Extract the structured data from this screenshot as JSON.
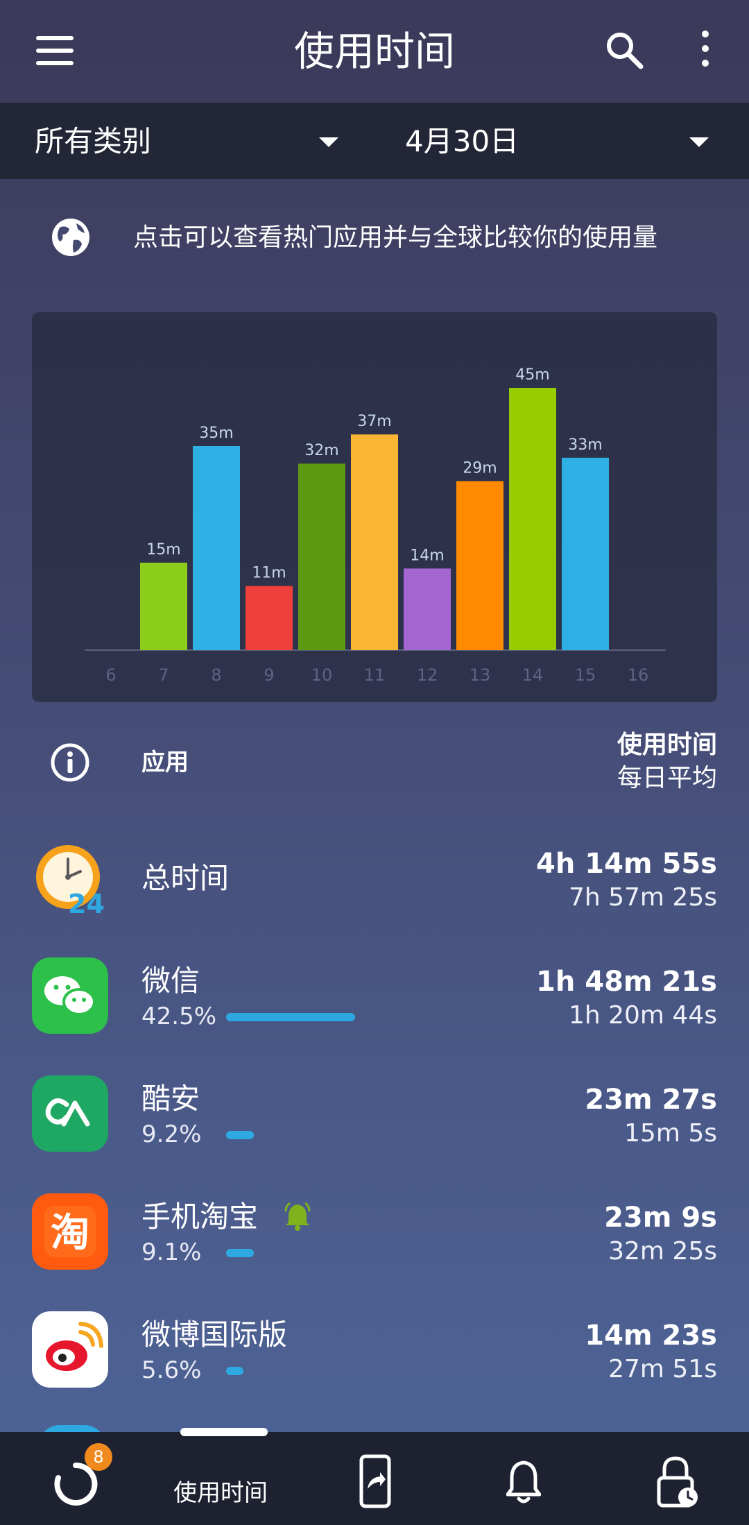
{
  "header": {
    "title": "使用时间"
  },
  "filters": {
    "category": "所有类别",
    "date": "4月30日"
  },
  "hint": {
    "text": "点击可以查看热门应用并与全球比较你的使用量"
  },
  "chart_data": {
    "type": "bar",
    "x_ticks": [
      "6",
      "7",
      "8",
      "9",
      "10",
      "11",
      "12",
      "13",
      "14",
      "15",
      "16"
    ],
    "categories": [
      "7",
      "8",
      "9",
      "10",
      "11",
      "12",
      "13",
      "14",
      "15"
    ],
    "values": [
      15,
      35,
      11,
      32,
      37,
      14,
      29,
      45,
      33
    ],
    "labels": [
      "15m",
      "35m",
      "11m",
      "32m",
      "37m",
      "14m",
      "29m",
      "45m",
      "33m"
    ],
    "colors": [
      "#8ccc1a",
      "#2eb0e4",
      "#f0403c",
      "#5d9a10",
      "#fbb534",
      "#a466d0",
      "#ff8a00",
      "#96cc00",
      "#2eb0e4"
    ],
    "unit": "minutes",
    "ylim": [
      0,
      50
    ],
    "grid": false,
    "legend": "none"
  },
  "list_header": {
    "app_label": "应用",
    "usage_label": "使用时间",
    "avg_label": "每日平均"
  },
  "apps": [
    {
      "name": "总时间",
      "percent": "",
      "share": 0,
      "time": "4h 14m 55s",
      "avg": "7h 57m 25s",
      "icon": "clock-24-icon"
    },
    {
      "name": "微信",
      "percent": "42.5%",
      "share": 0.425,
      "time": "1h 48m 21s",
      "avg": "1h 20m 44s",
      "icon": "wechat-icon",
      "color": "#2dc04a"
    },
    {
      "name": "酷安",
      "percent": "9.2%",
      "share": 0.092,
      "time": "23m 27s",
      "avg": "15m 5s",
      "icon": "coolapk-icon",
      "color": "#1fa864"
    },
    {
      "name": "手机淘宝",
      "percent": "9.1%",
      "share": 0.091,
      "time": "23m 9s",
      "avg": "32m 25s",
      "icon": "taobao-icon",
      "color": "#ff5a10",
      "alert": "bell-icon"
    },
    {
      "name": "微博国际版",
      "percent": "5.6%",
      "share": 0.056,
      "time": "14m 23s",
      "avg": "27m 51s",
      "icon": "weibo-icon",
      "color": "#ffffff"
    }
  ],
  "bottom_nav": {
    "badge": "8",
    "active_label": "使用时间"
  },
  "colors": {
    "accent": "#2ea8e0",
    "badge": "#f08a1c",
    "nav_bg": "#1e2130",
    "filter_bg": "#232636"
  }
}
